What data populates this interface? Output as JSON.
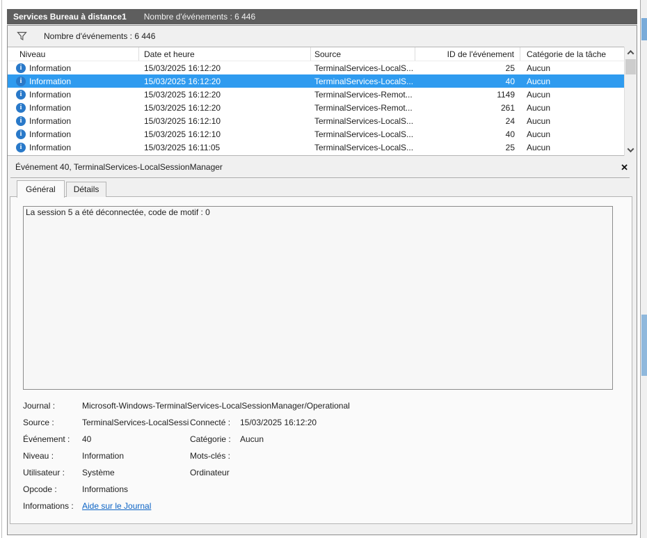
{
  "header": {
    "title": "Services Bureau à distance1",
    "count": "Nombre d'événements : 6 446"
  },
  "filter_bar": {
    "label": "Nombre d'événements : 6 446",
    "icon": "funnel-icon"
  },
  "table": {
    "columns": [
      "Niveau",
      "Date et heure",
      "Source",
      "ID de l'événement",
      "Catégorie de la tâche"
    ],
    "rows": [
      {
        "level": "Information",
        "datetime": "15/03/2025 16:12:20",
        "source": "TerminalServices-LocalS...",
        "event_id": "25",
        "category": "Aucun",
        "selected": false
      },
      {
        "level": "Information",
        "datetime": "15/03/2025 16:12:20",
        "source": "TerminalServices-LocalS...",
        "event_id": "40",
        "category": "Aucun",
        "selected": true
      },
      {
        "level": "Information",
        "datetime": "15/03/2025 16:12:20",
        "source": "TerminalServices-Remot...",
        "event_id": "1149",
        "category": "Aucun",
        "selected": false
      },
      {
        "level": "Information",
        "datetime": "15/03/2025 16:12:20",
        "source": "TerminalServices-Remot...",
        "event_id": "261",
        "category": "Aucun",
        "selected": false
      },
      {
        "level": "Information",
        "datetime": "15/03/2025 16:12:10",
        "source": "TerminalServices-LocalS...",
        "event_id": "24",
        "category": "Aucun",
        "selected": false
      },
      {
        "level": "Information",
        "datetime": "15/03/2025 16:12:10",
        "source": "TerminalServices-LocalS...",
        "event_id": "40",
        "category": "Aucun",
        "selected": false
      },
      {
        "level": "Information",
        "datetime": "15/03/2025 16:11:05",
        "source": "TerminalServices-LocalS...",
        "event_id": "25",
        "category": "Aucun",
        "selected": false
      }
    ],
    "scrollbar": {
      "up_icon": "chevron-up",
      "down_icon": "chevron-down"
    }
  },
  "detail": {
    "title": "Événement 40, TerminalServices-LocalSessionManager",
    "close_glyph": "✕",
    "tabs": [
      {
        "label": "Général",
        "active": true
      },
      {
        "label": "Détails",
        "active": false
      }
    ],
    "message": "La session 5 a été déconnectée, code de motif : 0",
    "rows": [
      {
        "l1": "Journal :",
        "v1": "Microsoft-Windows-TerminalServices-LocalSessionManager/Operational",
        "l2": "",
        "v2": "",
        "wide": true,
        "link": false
      },
      {
        "l1": "Source :",
        "v1": "TerminalServices-LocalSessi",
        "l2": "Connecté :",
        "v2": "15/03/2025 16:12:20",
        "wide": false,
        "link": false
      },
      {
        "l1": "Événement :",
        "v1": "40",
        "l2": "Catégorie :",
        "v2": "Aucun",
        "wide": false,
        "link": false
      },
      {
        "l1": "Niveau :",
        "v1": "Information",
        "l2": "Mots-clés :",
        "v2": "",
        "wide": false,
        "link": false
      },
      {
        "l1": "Utilisateur :",
        "v1": "Système",
        "l2": "Ordinateur",
        "v2": "",
        "wide": false,
        "link": false
      },
      {
        "l1": "Opcode :",
        "v1": "Informations",
        "l2": "",
        "v2": "",
        "wide": false,
        "link": false
      },
      {
        "l1": "Informations :",
        "v1": "Aide sur le Journal",
        "l2": "",
        "v2": "",
        "wide": false,
        "link": true
      }
    ]
  },
  "icons": {
    "info_glyph": "i"
  },
  "colors": {
    "titlebar": "#5e5e5e",
    "selection": "#2f9bef",
    "info_icon": "#2979c9",
    "link": "#0b63c5"
  }
}
